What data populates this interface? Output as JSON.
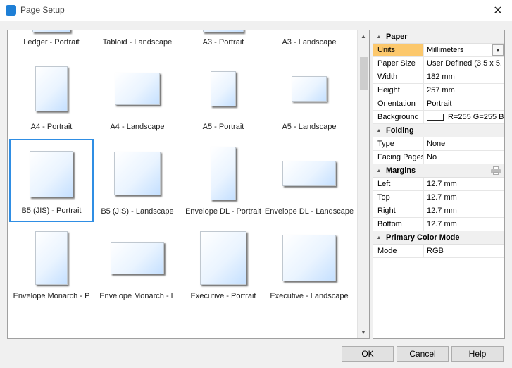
{
  "window": {
    "title": "Page Setup",
    "close_glyph": "✕"
  },
  "gallery": {
    "items": [
      {
        "label": "Ledger - Portrait",
        "selected": false,
        "w": 54,
        "h": 80
      },
      {
        "label": "Tabloid - Landscape",
        "selected": false,
        "w": 76,
        "h": 50
      },
      {
        "label": "A3 - Portrait",
        "selected": false,
        "w": 58,
        "h": 80
      },
      {
        "label": "A3 - Landscape",
        "selected": false,
        "w": 78,
        "h": 50
      },
      {
        "label": "A4 - Portrait",
        "selected": false,
        "w": 46,
        "h": 64
      },
      {
        "label": "A4 - Landscape",
        "selected": false,
        "w": 64,
        "h": 46
      },
      {
        "label": "A5 - Portrait",
        "selected": false,
        "w": 36,
        "h": 50
      },
      {
        "label": "A5 - Landscape",
        "selected": false,
        "w": 50,
        "h": 36
      },
      {
        "label": "B5 (JIS) - Portrait",
        "selected": true,
        "w": 62,
        "h": 66
      },
      {
        "label": "B5 (JIS) - Landscape",
        "selected": false,
        "w": 66,
        "h": 62
      },
      {
        "label": "Envelope DL - Portrait",
        "selected": false,
        "w": 36,
        "h": 76
      },
      {
        "label": "Envelope DL - Landscape",
        "selected": false,
        "w": 76,
        "h": 36
      },
      {
        "label": "Envelope Monarch - P",
        "selected": false,
        "w": 46,
        "h": 76
      },
      {
        "label": "Envelope Monarch - L",
        "selected": false,
        "w": 76,
        "h": 46
      },
      {
        "label": "Executive - Portrait",
        "selected": false,
        "w": 66,
        "h": 76
      },
      {
        "label": "Executive - Landscape",
        "selected": false,
        "w": 76,
        "h": 66
      }
    ]
  },
  "properties": {
    "paper": {
      "group": "Paper",
      "units_label": "Units",
      "units_value": "Millimeters",
      "size_label": "Paper Size",
      "size_value": "User Defined (3.5 x 5.",
      "width_label": "Width",
      "width_value": "182 mm",
      "height_label": "Height",
      "height_value": "257 mm",
      "orientation_label": "Orientation",
      "orientation_value": "Portrait",
      "background_label": "Background",
      "background_value": "R=255 G=255 B",
      "background_color": "#ffffff"
    },
    "folding": {
      "group": "Folding",
      "type_label": "Type",
      "type_value": "None",
      "facing_label": "Facing Pages",
      "facing_value": "No"
    },
    "margins": {
      "group": "Margins",
      "left_label": "Left",
      "left_value": "12.7 mm",
      "top_label": "Top",
      "top_value": "12.7 mm",
      "right_label": "Right",
      "right_value": "12.7 mm",
      "bottom_label": "Bottom",
      "bottom_value": "12.7 mm"
    },
    "color_mode": {
      "group": "Primary Color Mode",
      "mode_label": "Mode",
      "mode_value": "RGB"
    }
  },
  "buttons": {
    "ok": "OK",
    "cancel": "Cancel",
    "help": "Help"
  },
  "icons": {
    "app": "page-setup-app-icon",
    "collapse": "▲",
    "dropdown": "chevron-down-icon"
  },
  "colors": {
    "selection": "#2f8ee4",
    "active_property": "#fcc86c"
  }
}
